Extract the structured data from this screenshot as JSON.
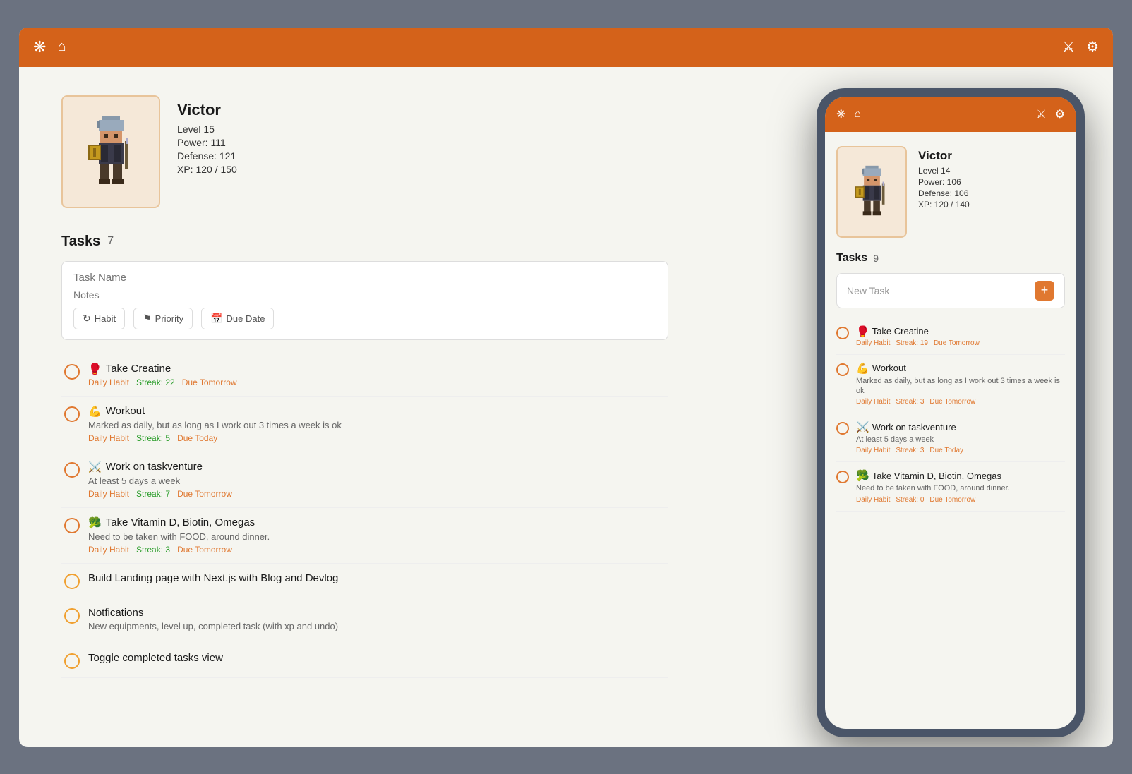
{
  "nav": {
    "logo": "❋",
    "home_icon": "⌂",
    "sword_icon": "⚔",
    "settings_icon": "⚙"
  },
  "desktop": {
    "profile": {
      "name": "Victor",
      "level": "Level 15",
      "power": "Power: 111",
      "defense": "Defense: 121",
      "xp": "XP: 120 / 150"
    },
    "tasks_title": "Tasks",
    "tasks_count": "7",
    "task_input": {
      "name_placeholder": "Task Name",
      "notes_placeholder": "Notes",
      "habit_btn": "Habit",
      "priority_btn": "Priority",
      "due_date_btn": "Due Date"
    },
    "tasks": [
      {
        "emoji": "🥊",
        "name": "Take Creatine",
        "description": "",
        "tags": [
          "Daily Habit",
          "Streak: 22"
        ],
        "due": "Due Tomorrow",
        "checkbox_color": "orange"
      },
      {
        "emoji": "💪",
        "name": "Workout",
        "description": "Marked as daily, but as long as I work out 3 times a week is ok",
        "tags": [
          "Daily Habit",
          "Streak: 5"
        ],
        "due": "Due Today",
        "checkbox_color": "orange"
      },
      {
        "emoji": "⚔",
        "name": "Work on taskventure",
        "description": "At least 5 days a week",
        "tags": [
          "Daily Habit",
          "Streak: 7"
        ],
        "due": "Due Tomorrow",
        "checkbox_color": "orange"
      },
      {
        "emoji": "🥦",
        "name": "Take Vitamin D, Biotin, Omegas",
        "description": "Need to be taken with FOOD, around dinner.",
        "tags": [
          "Daily Habit",
          "Streak: 3"
        ],
        "due": "Due Tomorrow",
        "checkbox_color": "orange"
      },
      {
        "emoji": "",
        "name": "Build Landing page with Next.js with Blog and Devlog",
        "description": "",
        "tags": [],
        "due": "",
        "checkbox_color": "yellow"
      },
      {
        "emoji": "",
        "name": "Notfications",
        "description": "New equipments, level up, completed task (with xp and undo)",
        "tags": [],
        "due": "",
        "checkbox_color": "yellow"
      },
      {
        "emoji": "",
        "name": "Toggle completed tasks view",
        "description": "",
        "tags": [],
        "due": "",
        "checkbox_color": "yellow"
      }
    ]
  },
  "mobile": {
    "profile": {
      "name": "Victor",
      "level": "Level 14",
      "power": "Power: 106",
      "defense": "Defense: 106",
      "xp": "XP: 120 / 140"
    },
    "tasks_title": "Tasks",
    "tasks_count": "9",
    "new_task_placeholder": "New Task",
    "add_btn": "+",
    "tasks": [
      {
        "emoji": "🥊",
        "name": "Take Creatine",
        "description": "",
        "tags": [
          "Daily Habit",
          "Streak: 19"
        ],
        "due": "Due Tomorrow"
      },
      {
        "emoji": "💪",
        "name": "Workout",
        "description": "Marked as daily, but as long as I work out 3 times a week is ok",
        "tags": [
          "Daily Habit",
          "Streak: 3"
        ],
        "due": "Due Tomorrow"
      },
      {
        "emoji": "⚔",
        "name": "Work on taskventure",
        "description": "At least 5 days a week",
        "tags": [
          "Daily Habit",
          "Streak: 3"
        ],
        "due": "Due Today"
      },
      {
        "emoji": "🥦",
        "name": "Take Vitamin D, Biotin, Omegas",
        "description": "Need to be taken with FOOD, around dinner.",
        "tags": [
          "Daily Habit",
          "Streak: 0"
        ],
        "due": "Due Tomorrow"
      }
    ]
  }
}
